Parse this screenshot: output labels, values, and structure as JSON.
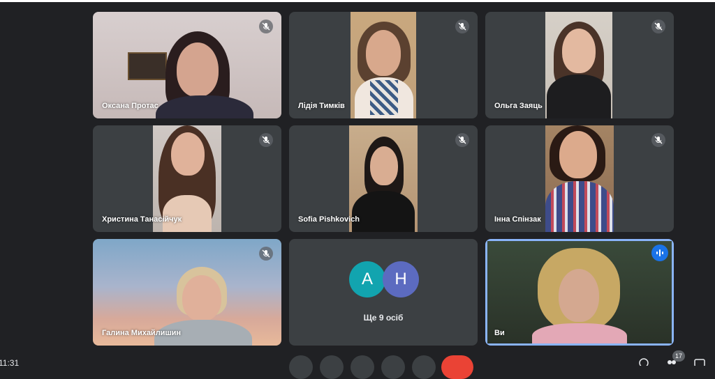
{
  "participants": [
    {
      "name": "Оксана Протас",
      "muted": true
    },
    {
      "name": "Лідія Тимків",
      "muted": true
    },
    {
      "name": "Ольга Заяць",
      "muted": true
    },
    {
      "name": "Христина Танасійчук",
      "muted": true
    },
    {
      "name": "Sofia Pishkovich",
      "muted": true
    },
    {
      "name": "Інна Спінзак",
      "muted": true
    },
    {
      "name": "Галина Михайлишин",
      "muted": true
    },
    {
      "name": "Ви",
      "muted": false,
      "speaking": true
    }
  ],
  "overflow_tile": {
    "avatars": [
      {
        "letter": "A",
        "color": "#12a4af"
      },
      {
        "letter": "H",
        "color": "#5c6bc0"
      }
    ],
    "label": "Ще 9 осіб"
  },
  "bottom_bar": {
    "clock": "11:31",
    "participant_count": "17"
  },
  "colors": {
    "background": "#202124",
    "tile": "#3c4043",
    "active_outline": "#8ab4f8",
    "speaking_badge": "#1a73e8",
    "end_call": "#ea4335"
  }
}
